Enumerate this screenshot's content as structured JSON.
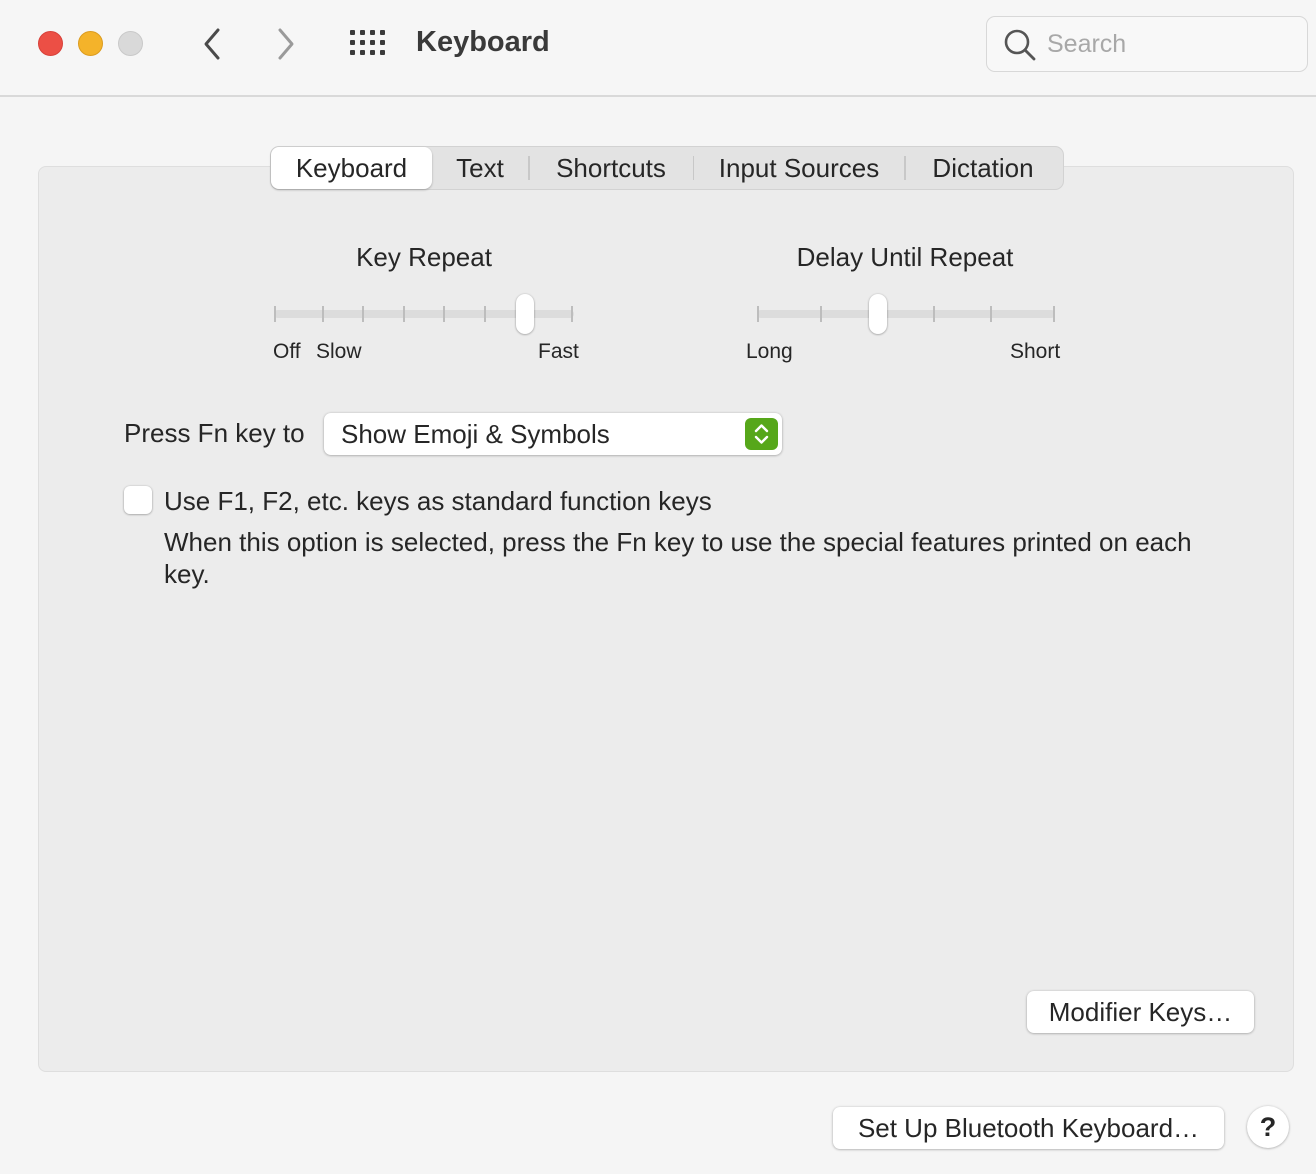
{
  "window": {
    "title": "Keyboard",
    "search_placeholder": "Search"
  },
  "tabs": [
    {
      "label": "Keyboard",
      "active": true
    },
    {
      "label": "Text",
      "active": false
    },
    {
      "label": "Shortcuts",
      "active": false
    },
    {
      "label": "Input Sources",
      "active": false
    },
    {
      "label": "Dictation",
      "active": false
    }
  ],
  "key_repeat": {
    "title": "Key Repeat",
    "labels": {
      "off": "Off",
      "slow": "Slow",
      "fast": "Fast"
    },
    "steps": 8,
    "selected_step": 6
  },
  "delay_until_repeat": {
    "title": "Delay Until Repeat",
    "labels": {
      "long": "Long",
      "short": "Short"
    },
    "steps": 6,
    "selected_step": 2
  },
  "fn_key": {
    "label": "Press Fn key to",
    "value": "Show Emoji & Symbols"
  },
  "function_keys": {
    "label": "Use F1, F2, etc. keys as standard function keys",
    "checked": false,
    "description": "When this option is selected, press the Fn key to use the special features printed on each key."
  },
  "buttons": {
    "modifier_keys": "Modifier Keys…",
    "bluetooth": "Set Up Bluetooth Keyboard…",
    "help": "?"
  },
  "colors": {
    "close": "#ec4f45",
    "minimize": "#f4b32a",
    "zoom_disabled": "#d9d9d9",
    "stepper_accent": "#56a71a"
  }
}
